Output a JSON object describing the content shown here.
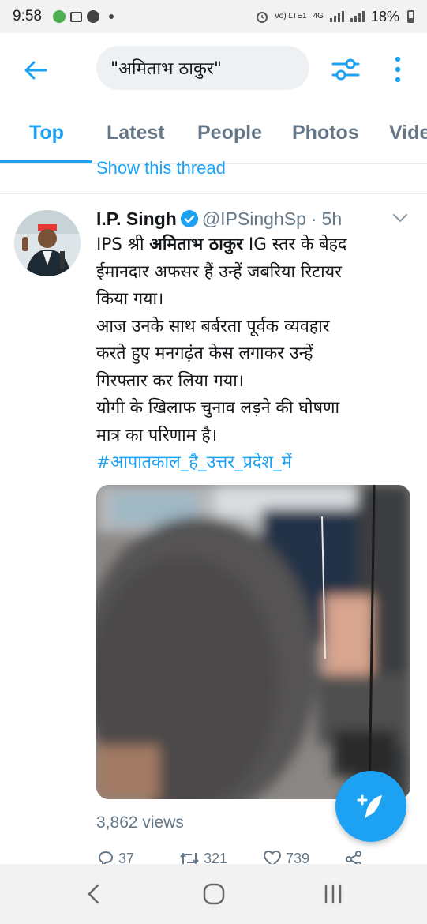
{
  "status_bar": {
    "time": "9:58",
    "network_label": "Vo) LTE1",
    "network_type": "4G",
    "battery": "18%"
  },
  "header": {
    "search_query": "\"अमिताभ ठाकुर\"",
    "icons": [
      "back-arrow-icon",
      "filter-icon",
      "more-vertical-icon"
    ]
  },
  "tabs": [
    {
      "label": "Top",
      "active": true
    },
    {
      "label": "Latest",
      "active": false
    },
    {
      "label": "People",
      "active": false
    },
    {
      "label": "Photos",
      "active": false
    },
    {
      "label": "Vide",
      "active": false
    }
  ],
  "previous_item": {
    "show_thread": "Show this thread"
  },
  "tweet": {
    "author_name": "I.P. Singh",
    "handle": "@IPSinghSp",
    "dot": "·",
    "time": "5h",
    "text_line1_pre": "IPS श्री ",
    "text_line1_bold": "अमिताभ ठाकुर",
    "text_line1_post": " IG स्तर के बेहद",
    "text_line2": "ईमानदार अफसर हैं उन्हें जबरिया रिटायर",
    "text_line3": "किया गया।",
    "text_line4": "आज उनके साथ बर्बरता पूर्वक व्यवहार",
    "text_line5": "करते हुए मनगढ़ंत केस लगाकर उन्हें",
    "text_line6": "गिरफ्तार कर लिया गया।",
    "text_line7": "योगी के खिलाफ चुनाव लड़ने की घोषणा",
    "text_line8": "मात्र का परिणाम है।",
    "hashtag": "#आपातकाल_है_उत्तर_प्रदेश_में",
    "views": "3,862 views",
    "replies": "37",
    "retweets": "321",
    "likes": "739"
  },
  "colors": {
    "accent": "#1da1f2",
    "secondary_text": "#657786",
    "primary_text": "#14171a"
  }
}
